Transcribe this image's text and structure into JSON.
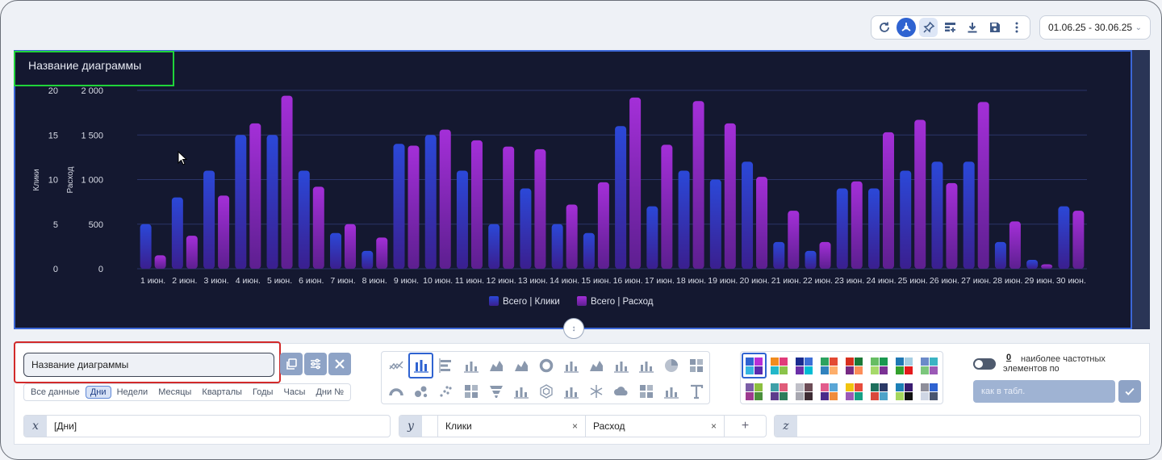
{
  "toolbar": {
    "icons": [
      "refresh-icon",
      "chart-mode-icon",
      "pin-icon",
      "add-table-icon",
      "download-icon",
      "save-icon",
      "more-icon"
    ],
    "date_range": "01.06.25 - 30.06.25"
  },
  "chart": {
    "title": "Название диаграммы"
  },
  "chart_data": {
    "type": "bar",
    "ylabel_left": "Клики",
    "ylabel_right": "Расход",
    "yticks_left": [
      "20",
      "15",
      "10",
      "5",
      "0"
    ],
    "yticks_right": [
      "2 000",
      "1 500",
      "1 000",
      "500",
      "0"
    ],
    "ylim_left": [
      0,
      20
    ],
    "ylim_right": [
      0,
      2000
    ],
    "grid": true,
    "legend_position": "bottom",
    "categories": [
      "1 июн.",
      "2 июн.",
      "3 июн.",
      "4 июн.",
      "5 июн.",
      "6 июн.",
      "7 июн.",
      "8 июн.",
      "9 июн.",
      "10 июн.",
      "11 июн.",
      "12 июн.",
      "13 июн.",
      "14 июн.",
      "15 июн.",
      "16 июн.",
      "17 июн.",
      "18 июн.",
      "19 июн.",
      "20 июн.",
      "21 июн.",
      "22 июн.",
      "23 июн.",
      "24 июн.",
      "25 июн.",
      "26 июн.",
      "27 июн.",
      "28 июн.",
      "29 июн.",
      "30 июн."
    ],
    "series": [
      {
        "name": "Всего | Клики",
        "axis": "left",
        "color": "#2c4ad6",
        "values": [
          5,
          8,
          11,
          15,
          15,
          11,
          4,
          2,
          14,
          15,
          11,
          5,
          9,
          5,
          4,
          16,
          7,
          11,
          10,
          12,
          3,
          2,
          9,
          9,
          11,
          12,
          12,
          3,
          1,
          7
        ]
      },
      {
        "name": "Всего | Расход",
        "axis": "right",
        "color": "#9a2fd0",
        "values": [
          150,
          370,
          820,
          1630,
          1940,
          920,
          500,
          350,
          1380,
          1560,
          1440,
          1370,
          1340,
          720,
          970,
          1920,
          1390,
          1880,
          1630,
          1030,
          650,
          300,
          980,
          1530,
          1670,
          960,
          1870,
          530,
          50,
          650
        ]
      }
    ]
  },
  "editor": {
    "name_value": "Название диаграммы",
    "periods": [
      "Все данные",
      "Дни",
      "Недели",
      "Месяцы",
      "Кварталы",
      "Годы",
      "Часы",
      "Дни №"
    ],
    "selected_period": "Дни",
    "freq_count": "0",
    "freq_text": "наиболее частотных элементов по",
    "table_placeholder": "как в табл.",
    "x_tag": "x",
    "x_value": "[Дни]",
    "y_tag": "y",
    "y_values": [
      "Клики",
      "Расход"
    ],
    "add_label": "+",
    "z_tag": "z",
    "remove_label": "×"
  }
}
